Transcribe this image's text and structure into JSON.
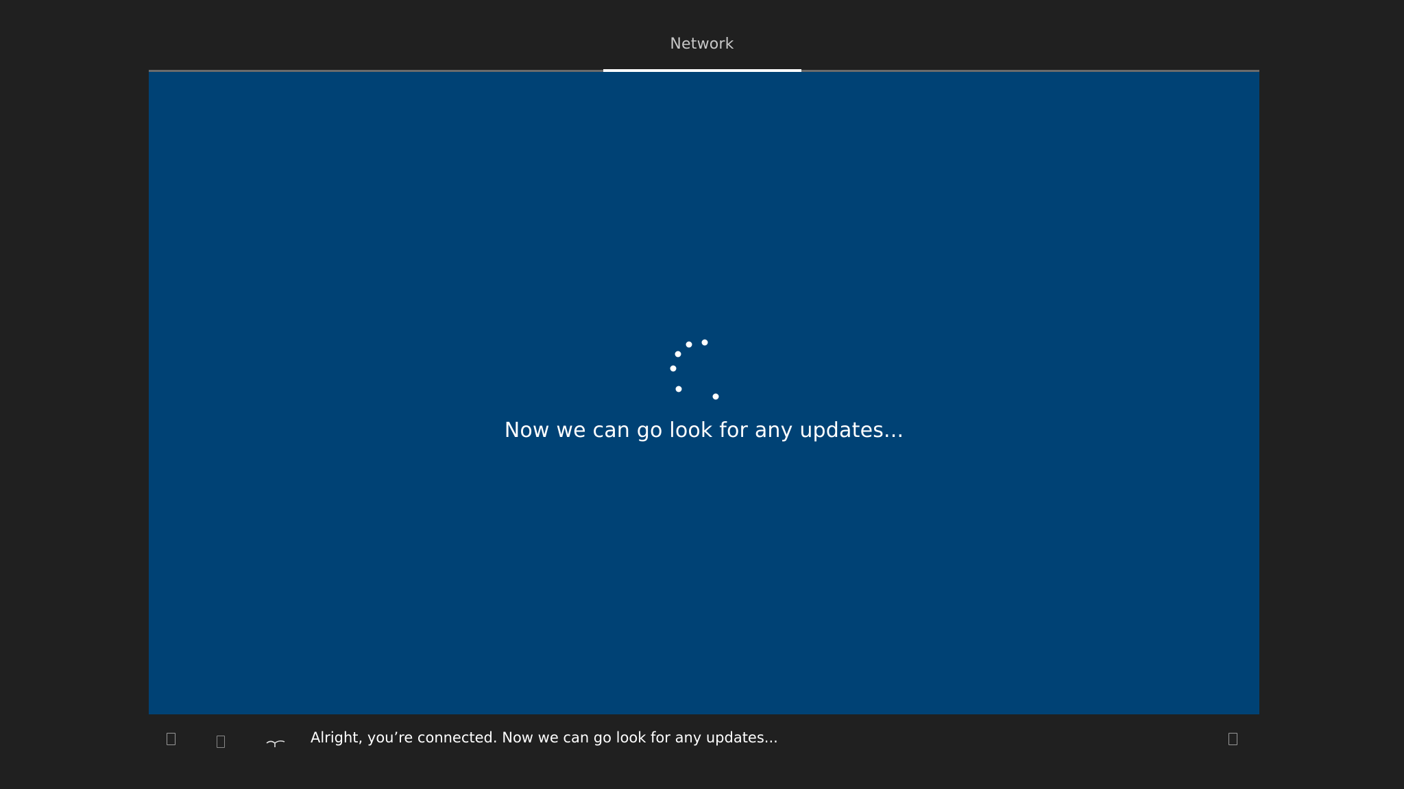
{
  "header": {
    "section_label": "Network"
  },
  "main": {
    "status_message": "Now we can go look for any updates...",
    "spinner_icon": "loading-dots-icon"
  },
  "bottom_bar": {
    "narration": "Alright, you’re connected.  Now we can go look for any updates...",
    "icons": {
      "ease_of_access": "ease-of-access-icon",
      "microphone": "microphone-icon",
      "volume": "volume-icon",
      "power": "power-icon"
    }
  },
  "colors": {
    "background": "#202020",
    "panel": "#004275",
    "text": "#ffffff",
    "progress_track": "#6b6b6b",
    "progress_active": "#ffffff"
  }
}
